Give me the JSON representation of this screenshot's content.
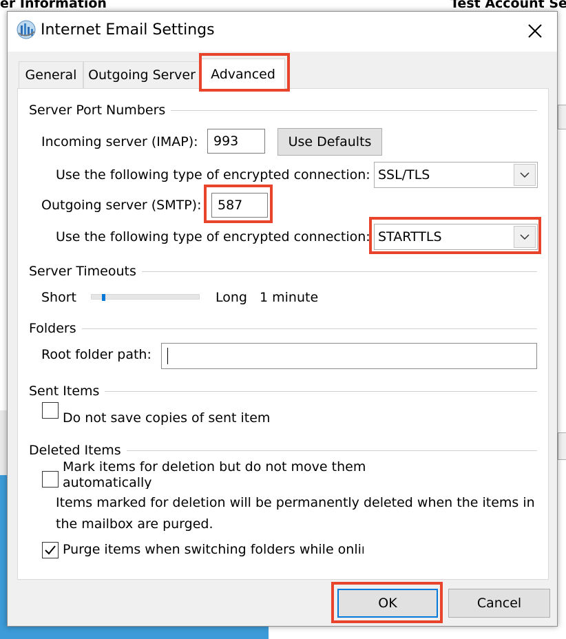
{
  "background": {
    "left_header": "er Information",
    "right_header": "Test Account Sett"
  },
  "dialog": {
    "title": "Internet Email Settings",
    "icon": "mail-settings-icon",
    "close_icon": "close-icon"
  },
  "tabs": [
    {
      "label": "General"
    },
    {
      "label": "Outgoing Server"
    },
    {
      "label": "Advanced"
    }
  ],
  "server_ports": {
    "section_title": "Server Port Numbers",
    "incoming_label": "Incoming server (IMAP):",
    "incoming_value": "993",
    "use_defaults_label": "Use Defaults",
    "incoming_encryption_label": "Use the following type of encrypted connection:",
    "incoming_encryption_value": "SSL/TLS",
    "outgoing_label": "Outgoing server (SMTP):",
    "outgoing_value": "587",
    "outgoing_encryption_label": "Use the following type of encrypted connection:",
    "outgoing_encryption_value": "STARTTLS"
  },
  "timeouts": {
    "section_title": "Server Timeouts",
    "short_label": "Short",
    "long_label": "Long",
    "value_label": "1 minute",
    "slider_level": 0.1
  },
  "folders": {
    "section_title": "Folders",
    "root_label": "Root folder path:",
    "root_value": ""
  },
  "sent_items": {
    "section_title": "Sent Items",
    "do_not_save_label": "Do not save copies of sent item",
    "do_not_save_checked": false
  },
  "deleted_items": {
    "section_title": "Deleted Items",
    "mark_label_line1": "Mark items for deletion but do not move them",
    "mark_label_line2": "automatically",
    "mark_checked": false,
    "info_line1": "Items marked for deletion will be permanently deleted when the items in",
    "info_line2": "the mailbox are purged.",
    "purge_label": "Purge items when switching folders while online",
    "purge_checked": true
  },
  "footer": {
    "ok_label": "OK",
    "cancel_label": "Cancel"
  },
  "colors": {
    "highlight": "#e8442b",
    "accent": "#0078d7",
    "background_blue": "#3c9bd8"
  }
}
